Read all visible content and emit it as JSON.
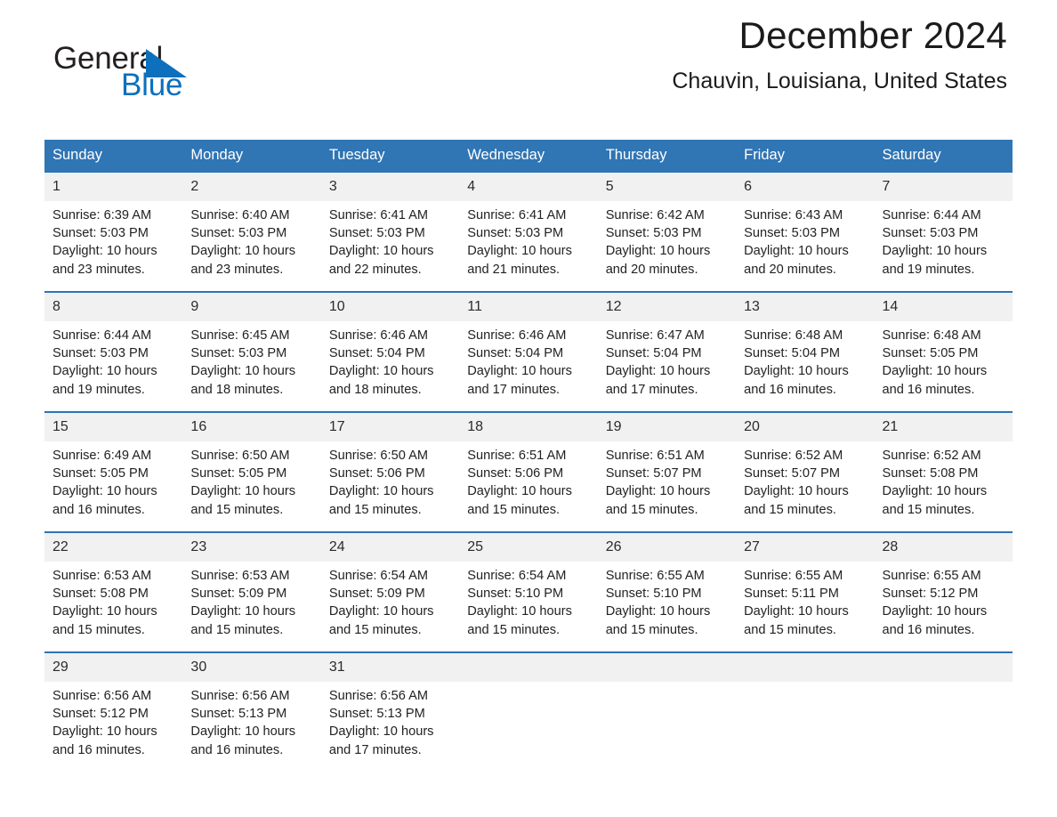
{
  "brand": {
    "name_part1": "General",
    "name_part2": "Blue",
    "triangle_color": "#0c70bc",
    "text_color": "#231f20"
  },
  "header": {
    "title": "December 2024",
    "subtitle": "Chauvin, Louisiana, United States"
  },
  "theme": {
    "header_bg": "#3075b4",
    "row_border": "#2e74b5",
    "daynum_bg": "#f1f1f1",
    "accent": "#0c70bc"
  },
  "calendar": {
    "weekday_headers": [
      "Sunday",
      "Monday",
      "Tuesday",
      "Wednesday",
      "Thursday",
      "Friday",
      "Saturday"
    ],
    "labels": {
      "sunrise": "Sunrise:",
      "sunset": "Sunset:",
      "daylight": "Daylight:"
    },
    "weeks": [
      [
        {
          "day": "1",
          "sunrise": "Sunrise: 6:39 AM",
          "sunset": "Sunset: 5:03 PM",
          "daylight": "Daylight: 10 hours and 23 minutes."
        },
        {
          "day": "2",
          "sunrise": "Sunrise: 6:40 AM",
          "sunset": "Sunset: 5:03 PM",
          "daylight": "Daylight: 10 hours and 23 minutes."
        },
        {
          "day": "3",
          "sunrise": "Sunrise: 6:41 AM",
          "sunset": "Sunset: 5:03 PM",
          "daylight": "Daylight: 10 hours and 22 minutes."
        },
        {
          "day": "4",
          "sunrise": "Sunrise: 6:41 AM",
          "sunset": "Sunset: 5:03 PM",
          "daylight": "Daylight: 10 hours and 21 minutes."
        },
        {
          "day": "5",
          "sunrise": "Sunrise: 6:42 AM",
          "sunset": "Sunset: 5:03 PM",
          "daylight": "Daylight: 10 hours and 20 minutes."
        },
        {
          "day": "6",
          "sunrise": "Sunrise: 6:43 AM",
          "sunset": "Sunset: 5:03 PM",
          "daylight": "Daylight: 10 hours and 20 minutes."
        },
        {
          "day": "7",
          "sunrise": "Sunrise: 6:44 AM",
          "sunset": "Sunset: 5:03 PM",
          "daylight": "Daylight: 10 hours and 19 minutes."
        }
      ],
      [
        {
          "day": "8",
          "sunrise": "Sunrise: 6:44 AM",
          "sunset": "Sunset: 5:03 PM",
          "daylight": "Daylight: 10 hours and 19 minutes."
        },
        {
          "day": "9",
          "sunrise": "Sunrise: 6:45 AM",
          "sunset": "Sunset: 5:03 PM",
          "daylight": "Daylight: 10 hours and 18 minutes."
        },
        {
          "day": "10",
          "sunrise": "Sunrise: 6:46 AM",
          "sunset": "Sunset: 5:04 PM",
          "daylight": "Daylight: 10 hours and 18 minutes."
        },
        {
          "day": "11",
          "sunrise": "Sunrise: 6:46 AM",
          "sunset": "Sunset: 5:04 PM",
          "daylight": "Daylight: 10 hours and 17 minutes."
        },
        {
          "day": "12",
          "sunrise": "Sunrise: 6:47 AM",
          "sunset": "Sunset: 5:04 PM",
          "daylight": "Daylight: 10 hours and 17 minutes."
        },
        {
          "day": "13",
          "sunrise": "Sunrise: 6:48 AM",
          "sunset": "Sunset: 5:04 PM",
          "daylight": "Daylight: 10 hours and 16 minutes."
        },
        {
          "day": "14",
          "sunrise": "Sunrise: 6:48 AM",
          "sunset": "Sunset: 5:05 PM",
          "daylight": "Daylight: 10 hours and 16 minutes."
        }
      ],
      [
        {
          "day": "15",
          "sunrise": "Sunrise: 6:49 AM",
          "sunset": "Sunset: 5:05 PM",
          "daylight": "Daylight: 10 hours and 16 minutes."
        },
        {
          "day": "16",
          "sunrise": "Sunrise: 6:50 AM",
          "sunset": "Sunset: 5:05 PM",
          "daylight": "Daylight: 10 hours and 15 minutes."
        },
        {
          "day": "17",
          "sunrise": "Sunrise: 6:50 AM",
          "sunset": "Sunset: 5:06 PM",
          "daylight": "Daylight: 10 hours and 15 minutes."
        },
        {
          "day": "18",
          "sunrise": "Sunrise: 6:51 AM",
          "sunset": "Sunset: 5:06 PM",
          "daylight": "Daylight: 10 hours and 15 minutes."
        },
        {
          "day": "19",
          "sunrise": "Sunrise: 6:51 AM",
          "sunset": "Sunset: 5:07 PM",
          "daylight": "Daylight: 10 hours and 15 minutes."
        },
        {
          "day": "20",
          "sunrise": "Sunrise: 6:52 AM",
          "sunset": "Sunset: 5:07 PM",
          "daylight": "Daylight: 10 hours and 15 minutes."
        },
        {
          "day": "21",
          "sunrise": "Sunrise: 6:52 AM",
          "sunset": "Sunset: 5:08 PM",
          "daylight": "Daylight: 10 hours and 15 minutes."
        }
      ],
      [
        {
          "day": "22",
          "sunrise": "Sunrise: 6:53 AM",
          "sunset": "Sunset: 5:08 PM",
          "daylight": "Daylight: 10 hours and 15 minutes."
        },
        {
          "day": "23",
          "sunrise": "Sunrise: 6:53 AM",
          "sunset": "Sunset: 5:09 PM",
          "daylight": "Daylight: 10 hours and 15 minutes."
        },
        {
          "day": "24",
          "sunrise": "Sunrise: 6:54 AM",
          "sunset": "Sunset: 5:09 PM",
          "daylight": "Daylight: 10 hours and 15 minutes."
        },
        {
          "day": "25",
          "sunrise": "Sunrise: 6:54 AM",
          "sunset": "Sunset: 5:10 PM",
          "daylight": "Daylight: 10 hours and 15 minutes."
        },
        {
          "day": "26",
          "sunrise": "Sunrise: 6:55 AM",
          "sunset": "Sunset: 5:10 PM",
          "daylight": "Daylight: 10 hours and 15 minutes."
        },
        {
          "day": "27",
          "sunrise": "Sunrise: 6:55 AM",
          "sunset": "Sunset: 5:11 PM",
          "daylight": "Daylight: 10 hours and 15 minutes."
        },
        {
          "day": "28",
          "sunrise": "Sunrise: 6:55 AM",
          "sunset": "Sunset: 5:12 PM",
          "daylight": "Daylight: 10 hours and 16 minutes."
        }
      ],
      [
        {
          "day": "29",
          "sunrise": "Sunrise: 6:56 AM",
          "sunset": "Sunset: 5:12 PM",
          "daylight": "Daylight: 10 hours and 16 minutes."
        },
        {
          "day": "30",
          "sunrise": "Sunrise: 6:56 AM",
          "sunset": "Sunset: 5:13 PM",
          "daylight": "Daylight: 10 hours and 16 minutes."
        },
        {
          "day": "31",
          "sunrise": "Sunrise: 6:56 AM",
          "sunset": "Sunset: 5:13 PM",
          "daylight": "Daylight: 10 hours and 17 minutes."
        },
        {
          "day": "",
          "sunrise": "",
          "sunset": "",
          "daylight": ""
        },
        {
          "day": "",
          "sunrise": "",
          "sunset": "",
          "daylight": ""
        },
        {
          "day": "",
          "sunrise": "",
          "sunset": "",
          "daylight": ""
        },
        {
          "day": "",
          "sunrise": "",
          "sunset": "",
          "daylight": ""
        }
      ]
    ]
  }
}
